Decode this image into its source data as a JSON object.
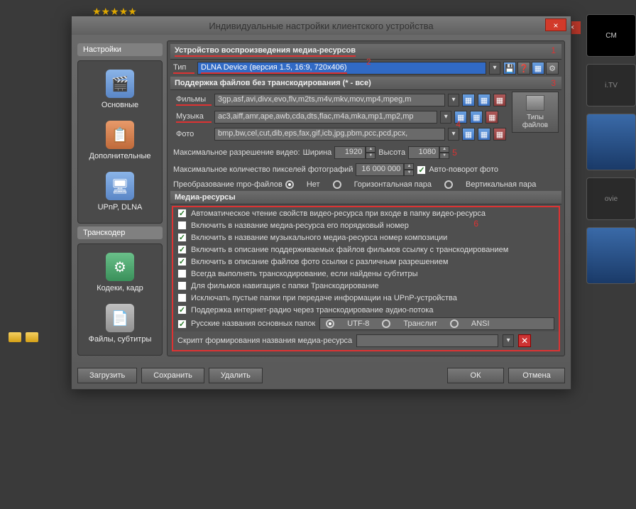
{
  "bg": {
    "close_x": "×",
    "stars": "★★★★★",
    "movie_lbl": "ovie"
  },
  "dialog": {
    "title": "Индивидуальные настройки клиентского устройства",
    "close": "×"
  },
  "sidebar": {
    "section1": "Настройки",
    "items": [
      {
        "label": "Основные"
      },
      {
        "label": "Дополнительные"
      },
      {
        "label": "UPnP, DLNA"
      }
    ],
    "section2": "Транскодер",
    "items2": [
      {
        "label": "Кодеки, кадр"
      },
      {
        "label": "Файлы, субтитры"
      }
    ]
  },
  "device": {
    "title": "Устройство воспроизведения медиа-ресурсов",
    "type_lbl": "Тип",
    "type_val": "DLNA Device (версия 1.5, 16:9, 720x406)",
    "anno1": "1",
    "anno2": "2"
  },
  "support": {
    "title": "Поддержка файлов без транскодирования (* - все)",
    "anno3": "3",
    "rows": [
      {
        "lbl": "Фильмы",
        "val": "3gp,asf,avi,divx,evo,flv,m2ts,m4v,mkv,mov,mp4,mpeg,m"
      },
      {
        "lbl": "Музыка",
        "val": "ac3,aiff,amr,ape,awb,cda,dts,flac,m4a,mka,mp1,mp2,mp"
      },
      {
        "lbl": "Фото",
        "val": "bmp,bw,cel,cut,dib,eps,fax,gif,icb,jpg,pbm,pcc,pcd,pcx,"
      }
    ],
    "types_btn": "Типы файлов",
    "anno4": "4"
  },
  "res": {
    "maxres": "Максимальное разрешение видео:",
    "width_lbl": "Ширина",
    "width_val": "1920",
    "height_lbl": "Высота",
    "height_val": "1080",
    "anno5": "5",
    "maxpix": "Максимальное количество пикселей фотографий",
    "maxpix_val": "16 000 000",
    "autorot": "Авто-поворот фото",
    "mpo": "Преобразование mpo-файлов",
    "mpo_opts": [
      "Нет",
      "Горизонтальная пара",
      "Вертикальная пара"
    ]
  },
  "media": {
    "title": "Медиа-ресурсы",
    "anno6": "6",
    "checks": [
      {
        "on": true,
        "txt": "Автоматическое чтение свойств видео-ресурса при входе в папку видео-ресурса"
      },
      {
        "on": false,
        "txt": "Включить в название медиа-ресурса его порядковый номер"
      },
      {
        "on": true,
        "txt": "Включить в название музыкального медиа-ресурса номер композиции"
      },
      {
        "on": true,
        "txt": "Включить в описание поддерживаемых файлов фильмов ссылку с транскодированием"
      },
      {
        "on": true,
        "txt": "Включить в описание файлов фото ссылки с различным разрешением"
      },
      {
        "on": false,
        "txt": "Всегда выполнять транскодирование, если найдены субтитры"
      },
      {
        "on": false,
        "txt": "Для фильмов навигация с папки Транскодирование"
      },
      {
        "on": false,
        "txt": "Исключать пустые папки при передаче информации на  UPnP-устройства"
      },
      {
        "on": true,
        "txt": "Поддержка интернет-радио через транскодирование аудио-потока"
      }
    ],
    "names_chk": {
      "on": true,
      "txt": "Русские названия основных папок"
    },
    "names_opts": [
      "UTF-8",
      "Транслит",
      "ANSI"
    ],
    "script_lbl": "Скрипт формирования названия медиа-ресурса"
  },
  "footer": {
    "load": "Загрузить",
    "save": "Сохранить",
    "delete": "Удалить",
    "ok": "ОК",
    "cancel": "Отмена"
  }
}
